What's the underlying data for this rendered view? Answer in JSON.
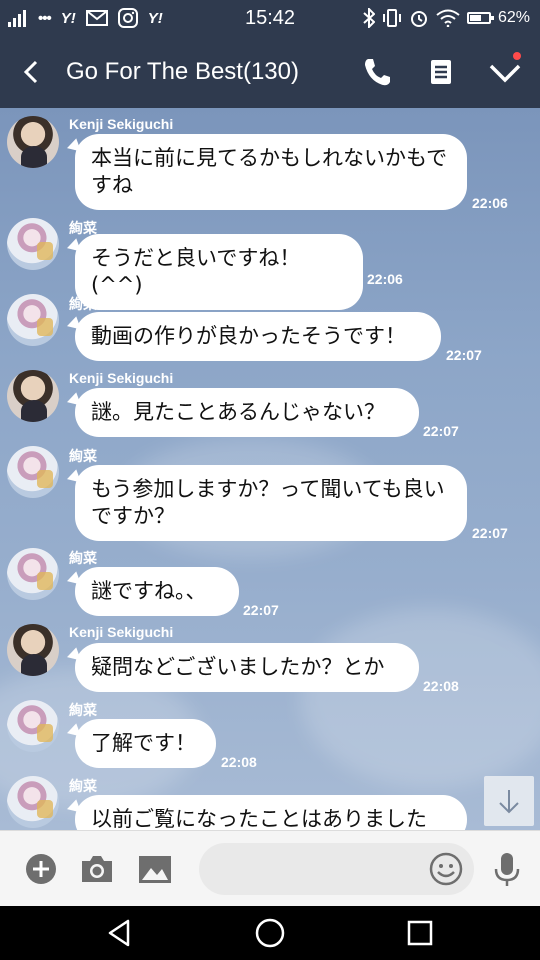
{
  "status_bar": {
    "left_icons": [
      "signal-icon",
      "more-dots-icon",
      "yahoo-icon",
      "mail-icon",
      "instagram-icon",
      "yahoo-icon"
    ],
    "yahoo_label": "Y!",
    "dots": "•••",
    "time": "15:42",
    "battery_level": 0.62,
    "battery_percent": "62%"
  },
  "header": {
    "title": "Go For The Best(130)",
    "has_notification": true
  },
  "messages": [
    {
      "sender": "Kenji Sekiguchi",
      "avatar": "kenji",
      "text": "本当に前に見てるかもしれないかもですね",
      "time": "22:06"
    },
    {
      "sender": "絢菜",
      "avatar": "aya",
      "text": "そうだと良いですね！(^^)",
      "time": "22:06"
    },
    {
      "sender": "絢菜",
      "avatar": "aya",
      "text": "動画の作りが良かったそうです！",
      "time": "22:07"
    },
    {
      "sender": "Kenji Sekiguchi",
      "avatar": "kenji",
      "text": "謎。見たことあるんじゃない？",
      "time": "22:07"
    },
    {
      "sender": "絢菜",
      "avatar": "aya",
      "text": "もう参加しますか？って聞いても良いですか？",
      "time": "22:07"
    },
    {
      "sender": "絢菜",
      "avatar": "aya",
      "text": "謎ですね。、",
      "time": "22:07"
    },
    {
      "sender": "Kenji Sekiguchi",
      "avatar": "kenji",
      "text": "疑問などございましたか？とか",
      "time": "22:08"
    },
    {
      "sender": "絢菜",
      "avatar": "aya",
      "text": "了解です！",
      "time": "22:08"
    },
    {
      "sender": "絢菜",
      "avatar": "aya",
      "text": "以前ご覧になったことはありました",
      "time": ""
    }
  ],
  "input": {
    "placeholder": "",
    "value": ""
  },
  "colors": {
    "header_bg": "#2f3a4e",
    "chat_bg": "#8da6c8",
    "bubble_bg": "#ffffff"
  }
}
